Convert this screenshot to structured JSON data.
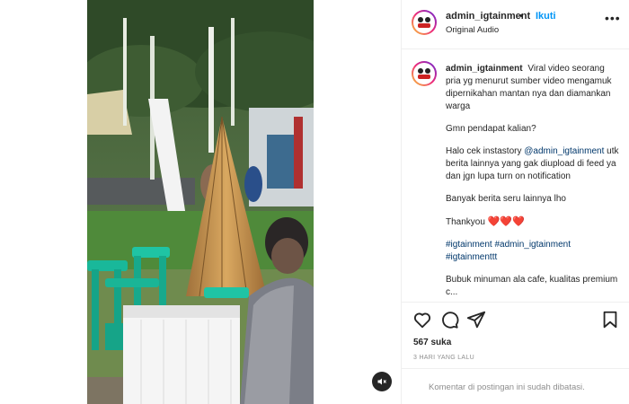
{
  "account": {
    "username": "admin_igtainment",
    "separator": "•",
    "follow_label": "Ikuti",
    "audio_label": "Original Audio",
    "more_label": "•••"
  },
  "caption": {
    "username": "admin_igtainment",
    "text": "Viral video seorang pria yg menurut sumber video mengamuk dipernikahan mantan nya dan diamankan warga",
    "paragraphs": [
      "Gmn pendapat kalian?",
      "utk berita lainnya yang gak diupload di feed ya dan jgn lupa turn on notification",
      "Banyak berita seru lainnya lho",
      "Thankyou",
      "Bubuk minuman ala cafe, kualitas"
    ],
    "mention_prefix": "Halo cek instastory",
    "mention": "@admin_igtainment",
    "hearts": "❤️❤️❤️",
    "hashtags": "#igtainment #admin_igtainment #igtainmenttt",
    "truncated_line": "premium c..."
  },
  "icons": {
    "like": "heart-outline-icon",
    "comment": "comment-bubble-icon",
    "share": "paper-plane-icon",
    "save": "bookmark-icon",
    "mute": "speaker-muted-icon"
  },
  "stats": {
    "likes": "567 suka",
    "time": "3 HARI YANG LALU"
  },
  "footer": {
    "comments_limited": "Komentar di postingan ini sudah dibatasi."
  },
  "colors": {
    "link": "#00376b",
    "follow": "#0095f6",
    "heart": "#e0245e",
    "muted_text": "#8e8e8e"
  }
}
